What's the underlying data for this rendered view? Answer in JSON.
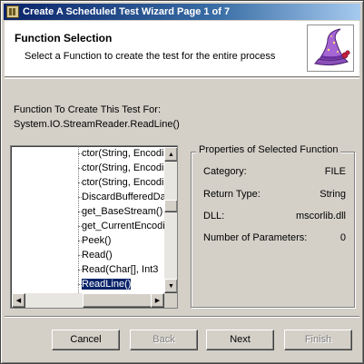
{
  "window": {
    "title": "Create A Scheduled Test Wizard Page 1 of 7"
  },
  "header": {
    "title": "Function Selection",
    "subtitle": "Select a Function to create the test for the entire process",
    "image_icon": "wizard-hat-icon"
  },
  "function": {
    "label": "Function To Create This Test For:",
    "value": "System.IO.StreamReader.ReadLine()"
  },
  "tree": {
    "items": [
      "ctor(String, Encodi",
      "ctor(String, Encodi",
      "ctor(String, Encodi",
      "DiscardBufferedDa",
      "get_BaseStream()",
      "get_CurrentEncodi",
      "Peek()",
      "Read()",
      "Read(Char[], Int3",
      "ReadLine()"
    ],
    "selected_index": 9
  },
  "properties": {
    "legend": "Properties of Selected Function",
    "rows": [
      {
        "label": "Category:",
        "value": "FILE"
      },
      {
        "label": "Return Type:",
        "value": "String"
      },
      {
        "label": "DLL:",
        "value": "mscorlib.dll"
      },
      {
        "label": "Number of Parameters:",
        "value": "0"
      }
    ]
  },
  "buttons": {
    "cancel": "Cancel",
    "back": "Back",
    "next": "Next",
    "finish": "Finish"
  }
}
